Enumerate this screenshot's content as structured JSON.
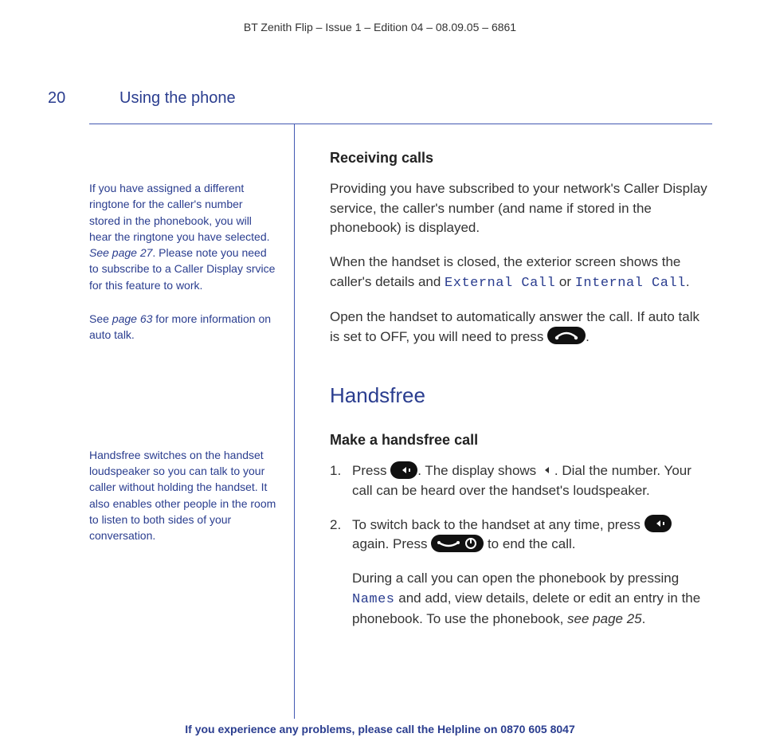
{
  "doc_header": "BT Zenith Flip – Issue 1 – Edition 04 – 08.09.05 – 6861",
  "page_number": "20",
  "section_title": "Using the phone",
  "sidebar": {
    "note1a": "If you have assigned a different ringtone for the caller's number stored in the phonebook, you will hear the ringtone you have selected. ",
    "note1a_link": "See page 27",
    "note1b": ". Please note you need to subscribe to a Caller Display srvice for this feature to work.",
    "note1c_pre": "See ",
    "note1c_link": "page 63",
    "note1c_post": " for more information on auto talk.",
    "note2": "Handsfree switches on the handset loudspeaker so you can talk to your caller without holding the handset. It also enables other people in the room to listen to both sides of your conversation."
  },
  "main": {
    "h_receiving": "Receiving calls",
    "p1": "Providing you have subscribed to your network's Caller Display service, the caller's number (and name if stored in the phonebook) is displayed.",
    "p2a": "When the handset is closed, the exterior screen shows the caller's details and ",
    "p2_ext": "External Call",
    "p2_or": " or ",
    "p2_int": "Internal Call",
    "p2_end": ".",
    "p3a": "Open the handset to automatically answer the call. If auto talk is set to OFF, you will need to press ",
    "p3b": ".",
    "h_handsfree": "Handsfree",
    "h_make": "Make a handsfree call",
    "s1a": "Press ",
    "s1b": ". The display shows ",
    "s1c": ". Dial the number. Your call can be heard over the handset's loudspeaker.",
    "s2a": "To switch back to the handset at any time, press ",
    "s2b": " again. Press ",
    "s2c": " to end the call.",
    "sub_a": "During a call you can open the phonebook by pressing ",
    "sub_names": "Names",
    "sub_b": " and add, view details, delete or edit an entry in the phonebook. To use the phonebook, ",
    "sub_link": "see page 25",
    "sub_end": "."
  },
  "footer": {
    "text": "If you experience any problems, please call the Helpline on ",
    "number": "0870 605 8047"
  }
}
